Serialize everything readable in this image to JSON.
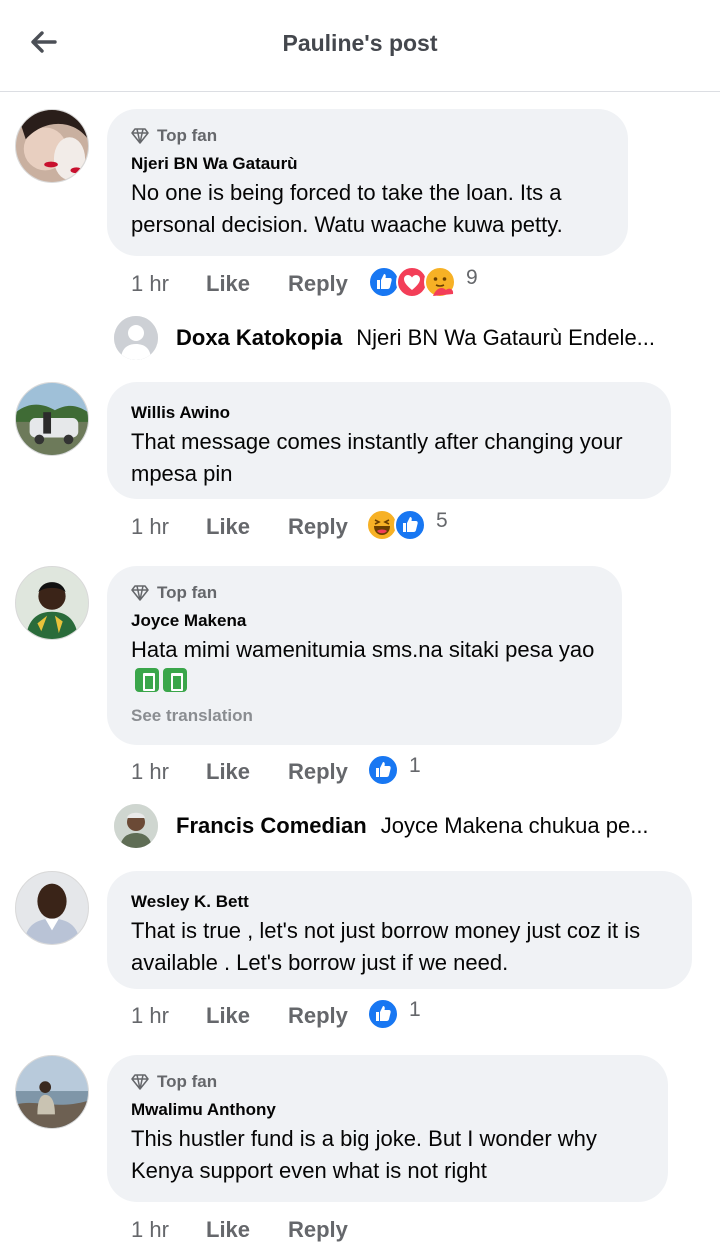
{
  "header": {
    "title": "Pauline's post"
  },
  "comments": [
    {
      "top_fan": "Top fan",
      "author": "Njeri BN Wa Gataurù",
      "text": "No one is being forced to take the loan. Its a personal decision. Watu waache kuwa petty.",
      "time": "1 hr",
      "like": "Like",
      "reply": "Reply",
      "reaction_count": "9",
      "reactions": [
        "like-icon",
        "love-icon",
        "care-icon"
      ]
    },
    {
      "author": "Willis Awino",
      "text": "That message  comes  instantly  after  changing your  mpesa pin",
      "time": "1 hr",
      "like": "Like",
      "reply": "Reply",
      "reaction_count": "5",
      "reactions": [
        "haha-icon",
        "like-icon"
      ]
    },
    {
      "top_fan": "Top fan",
      "author": "Joyce Makena",
      "text": "Hata mimi wamenitumia sms.na sitaki pesa yao",
      "see_translation": "See translation",
      "time": "1 hr",
      "like": "Like",
      "reply": "Reply",
      "reaction_count": "1",
      "reactions": [
        "like-icon"
      ]
    },
    {
      "author": "Wesley K. Bett",
      "text": "That is true , let's not just borrow money just coz it is available . Let's borrow just if we need.",
      "time": "1 hr",
      "like": "Like",
      "reply": "Reply",
      "reaction_count": "1",
      "reactions": [
        "like-icon"
      ]
    },
    {
      "top_fan": "Top fan",
      "author": "Mwalimu Anthony",
      "text": "This hustler fund is a big joke.  But I wonder why Kenya support even what is not right",
      "time": "1 hr",
      "like": "Like",
      "reply": "Reply"
    }
  ],
  "replies": [
    {
      "name": "Doxa Katokopia",
      "text": "Njeri BN Wa Gataurù Endele..."
    },
    {
      "name": "Francis  Comedian",
      "text": "Joyce Makena chukua pe..."
    }
  ],
  "colors": {
    "like_blue": "#1877f2",
    "love_red": "#f33e58",
    "bubble": "#f0f2f5",
    "muted": "#65676b"
  }
}
